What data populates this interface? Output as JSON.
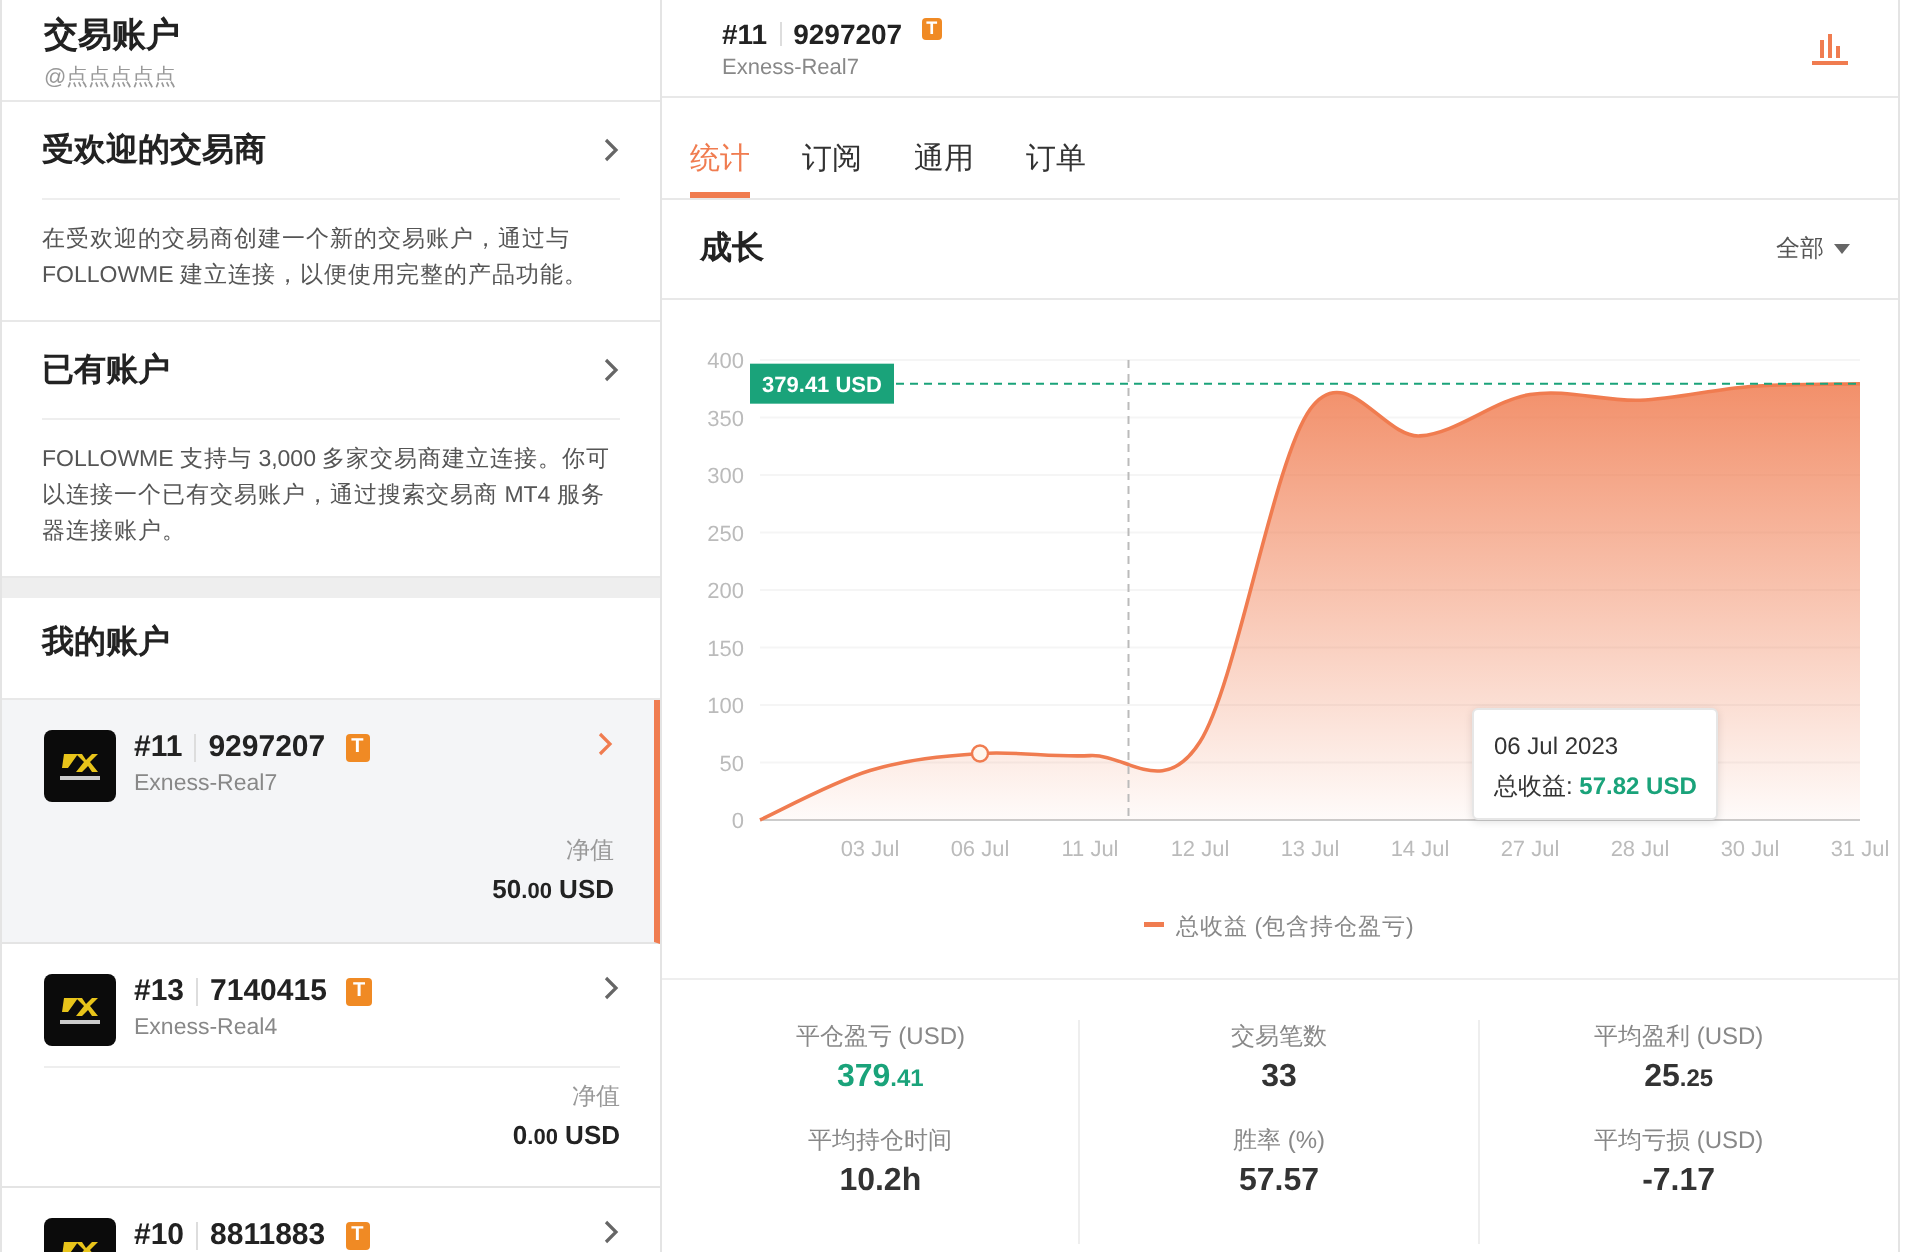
{
  "sidebar": {
    "title": "交易账户",
    "handle": "@点点点点点",
    "sections": [
      {
        "title": "受欢迎的交易商",
        "description": "在受欢迎的交易商创建一个新的交易账户，通过与 FOLLOWME 建立连接，以便使用完整的产品功能。"
      },
      {
        "title": "已有账户",
        "description": "FOLLOWME 支持与 3,000 多家交易商建立连接。你可以连接一个已有交易账户，通过搜索交易商 MT4 服务器连接账户。"
      }
    ],
    "accounts_title": "我的账户",
    "accounts": [
      {
        "index": "#11",
        "number": "9297207",
        "badge": "T",
        "server": "Exness-Real7",
        "equity_label": "净值",
        "equity": "50",
        "equity_decimals": ".00",
        "currency": "USD",
        "selected": true
      },
      {
        "index": "#13",
        "number": "7140415",
        "badge": "T",
        "server": "Exness-Real4",
        "equity_label": "净值",
        "equity": "0",
        "equity_decimals": ".00",
        "currency": "USD",
        "selected": false
      },
      {
        "index": "#10",
        "number": "8811883",
        "badge": "T",
        "selected": false
      }
    ]
  },
  "header": {
    "index": "#11",
    "number": "9297207",
    "badge": "T",
    "server": "Exness-Real7"
  },
  "tabs": [
    {
      "label": "统计",
      "selected": true
    },
    {
      "label": "订阅",
      "selected": false
    },
    {
      "label": "通用",
      "selected": false
    },
    {
      "label": "订单",
      "selected": false
    }
  ],
  "growth": {
    "title": "成长",
    "filter": "全部",
    "chart_data": {
      "type": "area",
      "categories": [
        null,
        "03 Jul",
        "06 Jul",
        "11 Jul",
        "12 Jul",
        "13 Jul",
        "14 Jul",
        "27 Jul",
        "28 Jul",
        "30 Jul",
        "31 Jul"
      ],
      "ylim": [
        0,
        400
      ],
      "yticks": [
        0,
        50,
        100,
        150,
        200,
        250,
        300,
        350,
        400
      ],
      "series": [
        {
          "name": "总收益 (包含持仓盈亏)",
          "color": "#f07c50",
          "values": [
            0,
            43,
            57.82,
            56,
            68,
            357,
            334,
            370,
            365,
            377,
            379.41
          ]
        }
      ],
      "grid": true
    },
    "max_label": "379.41 USD",
    "tooltip": {
      "title": "06 Jul 2023",
      "label": "总收益:",
      "value": "57.82 USD"
    }
  },
  "stats": [
    {
      "label": "平仓盈亏 (USD)",
      "value": "379",
      "decimals": ".41",
      "color": "#1aa37a"
    },
    {
      "label": "交易笔数",
      "value": "33",
      "color": "#333333"
    },
    {
      "label": "平均盈利 (USD)",
      "value": "25",
      "decimals": ".25",
      "color": "#333333"
    },
    {
      "label": "平均持仓时间",
      "value": "10.2h",
      "color": "#333333"
    },
    {
      "label": "胜率 (%)",
      "value": "57.57",
      "color": "#333333"
    },
    {
      "label": "平均亏损 (USD)",
      "value": "-7.17",
      "color": "#333333"
    }
  ]
}
